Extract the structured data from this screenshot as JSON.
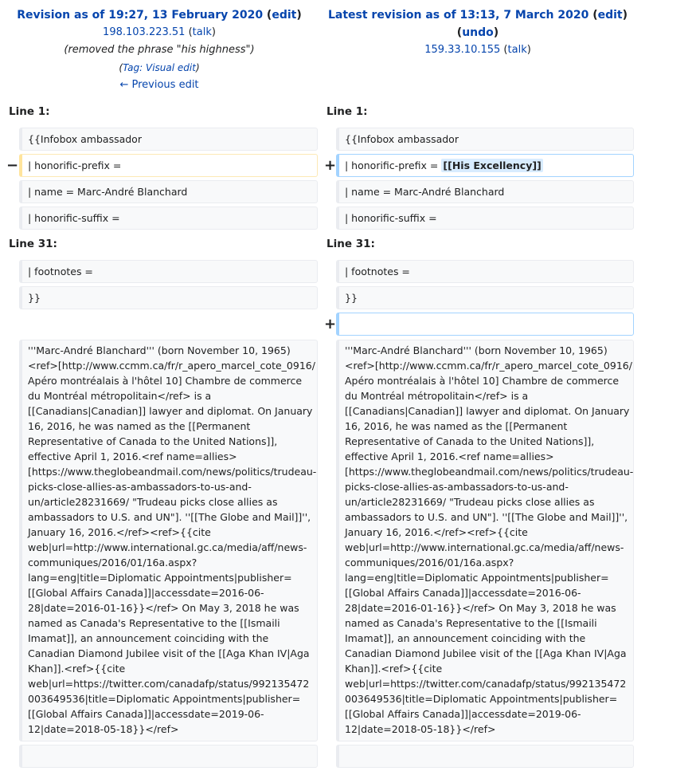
{
  "left_header": {
    "title": "Revision as of 19:27, 13 February 2020",
    "edit": "edit",
    "user": "198.103.223.51",
    "talk": "talk",
    "summary": "(removed the phrase \"his highness\")",
    "tag_label": "Tag:",
    "tag": "Visual edit",
    "prev": "← Previous edit"
  },
  "right_header": {
    "title": "Latest revision as of 13:13, 7 March 2020",
    "edit": "edit",
    "undo": "undo",
    "user": "159.33.10.155",
    "talk": "talk"
  },
  "line1": "Line 1:",
  "line31": "Line 31:",
  "rows": {
    "infobox": "{{Infobox ambassador",
    "prefix": "| honorific-prefix =",
    "added": "[[His Excellency]]",
    "name": "| name = Marc-André Blanchard",
    "suffix": "| honorific-suffix =",
    "footnotes": "| footnotes =",
    "close": "}}"
  },
  "markers": {
    "minus": "−",
    "plus": "+"
  },
  "paragraph_lines": [
    "'''Marc-André Blanchard''' (born November 10, 1965)",
    "<ref>[http://www.ccmm.ca/fr/r_apero_marcel_cote_0916/",
    "Apéro montréalais à l'hôtel 10] Chambre de commerce",
    "du Montréal métropolitain</ref> is a",
    "[[Canadians|Canadian]] lawyer and diplomat. On January",
    "16, 2016, he was named as the [[Permanent",
    "Representative of Canada to the United Nations]],",
    "effective April 1, 2016.<ref name=allies>",
    "[https://www.theglobeandmail.com/news/politics/trudeau-",
    "picks-close-allies-as-ambassadors-to-us-and-",
    "un/article28231669/ \"Trudeau picks close allies as",
    "ambassadors to U.S. and UN\"]. ''[[The Globe and Mail]]'',",
    "January 16, 2016.</ref><ref>{{cite",
    "web|url=http://www.international.gc.ca/media/aff/news-",
    "communiques/2016/01/16a.aspx?",
    "lang=eng|title=Diplomatic Appointments|publisher=",
    "[[Global Affairs Canada]]|accessdate=2016-06-",
    "28|date=2016-01-16}}</ref>  On May 3, 2018 he was",
    "named as Canada's Representative to the [[Ismaili",
    "Imamat]], an announcement coinciding with the",
    "Canadian Diamond Jubilee visit of the [[Aga Khan IV|Aga",
    "Khan]].<ref>{{cite",
    "web|url=https://twitter.com/canadafp/status/992135472",
    "003649536|title=Diplomatic Appointments|publisher=",
    "[[Global Affairs Canada]]|accessdate=2019-06-",
    "12|date=2018-05-18}}</ref>"
  ]
}
